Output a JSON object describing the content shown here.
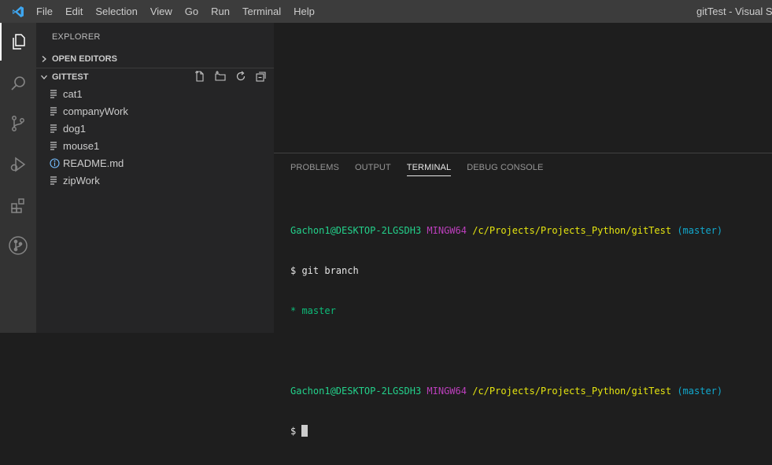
{
  "window": {
    "title": "gitTest - Visual Studio Code"
  },
  "menu": [
    "File",
    "Edit",
    "Selection",
    "View",
    "Go",
    "Run",
    "Terminal",
    "Help"
  ],
  "activity_bar": [
    "files-icon",
    "search-icon",
    "source-control-icon",
    "run-debug-icon",
    "extensions-icon",
    "git-graph-icon"
  ],
  "sidebar": {
    "title": "EXPLORER",
    "open_editors": "OPEN EDITORS",
    "folder": "GITTEST",
    "files": [
      {
        "name": "cat1",
        "icon": "text-file-icon"
      },
      {
        "name": "companyWork",
        "icon": "text-file-icon"
      },
      {
        "name": "dog1",
        "icon": "text-file-icon"
      },
      {
        "name": "mouse1",
        "icon": "text-file-icon"
      },
      {
        "name": "README.md",
        "icon": "info-icon"
      },
      {
        "name": "zipWork",
        "icon": "text-file-icon"
      }
    ]
  },
  "panel": {
    "tabs": [
      "PROBLEMS",
      "OUTPUT",
      "TERMINAL",
      "DEBUG CONSOLE"
    ],
    "active_tab": "TERMINAL"
  },
  "terminal": {
    "user_host": "Gachon1@DESKTOP-2LGSDH3",
    "shell": "MINGW64",
    "path": "/c/Projects/Projects_Python/gitTest",
    "branch": "(master)",
    "command": "$ git branch",
    "output": "* master",
    "prompt": "$ "
  },
  "colors": {
    "accent": "#007acc",
    "prompt_user": "#23d18b",
    "shell": "#bc3fbc",
    "path": "#e5e510",
    "branch": "#11a8cd"
  }
}
